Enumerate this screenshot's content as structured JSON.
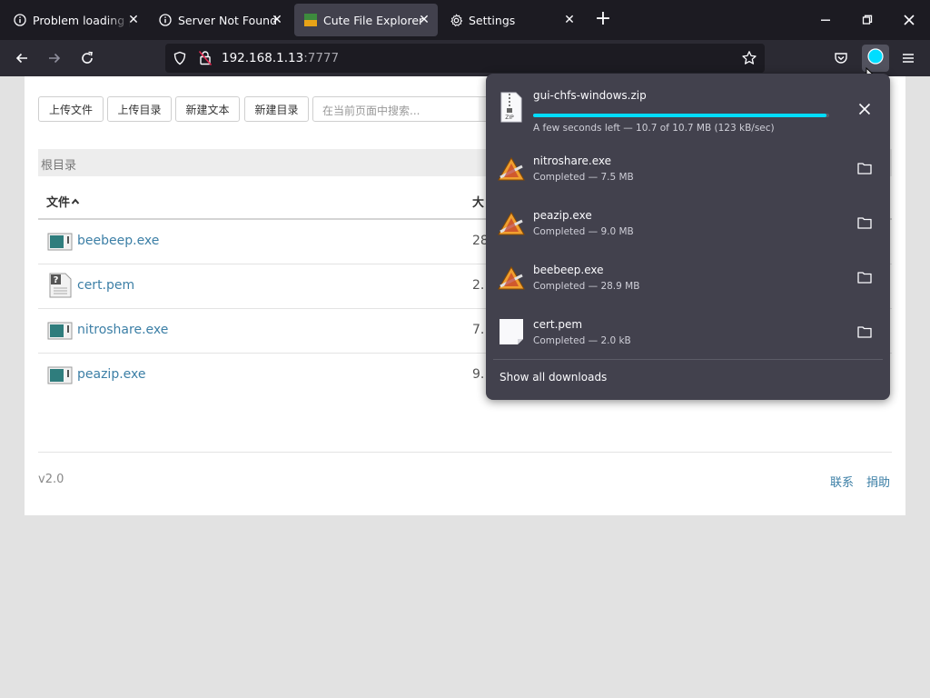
{
  "browser": {
    "tabs": [
      {
        "title": "Problem loading page",
        "icon": "info-icon",
        "active": false
      },
      {
        "title": "Server Not Found",
        "icon": "info-icon",
        "active": false
      },
      {
        "title": "Cute File Explorer",
        "icon": "site-favicon",
        "active": true
      },
      {
        "title": "Settings",
        "icon": "gear-icon",
        "active": false
      }
    ],
    "url_host": "192.168.1.13",
    "url_port": ":7777",
    "accent": "#00ddff"
  },
  "toolbar": {
    "upload_file": "上传文件",
    "upload_dir": "上传目录",
    "new_text": "新建文本",
    "new_dir": "新建目录",
    "search_placeholder": "在当前页面中搜索..."
  },
  "breadcrumb": "根目录",
  "table": {
    "col_file": "文件",
    "col_size": "大",
    "rows": [
      {
        "name": "beebeep.exe",
        "size": "28",
        "icon": "exe-file-icon"
      },
      {
        "name": "cert.pem",
        "size": "2.",
        "icon": "unknown-file-icon"
      },
      {
        "name": "nitroshare.exe",
        "size": "7.",
        "icon": "exe-file-icon"
      },
      {
        "name": "peazip.exe",
        "size": "9.",
        "icon": "exe-file-icon"
      }
    ]
  },
  "footer": {
    "version": "v2.0",
    "contact": "联系",
    "donate": "捐助"
  },
  "downloads": {
    "active": {
      "name": "gui-chfs-windows.zip",
      "status": "A few seconds left — 10.7 of 10.7 MB (123 kB/sec)",
      "progress": 0.99,
      "icon": "zip-file-icon"
    },
    "completed": [
      {
        "name": "nitroshare.exe",
        "status": "Completed — 7.5 MB",
        "icon": "exe-file-icon"
      },
      {
        "name": "peazip.exe",
        "status": "Completed — 9.0 MB",
        "icon": "exe-file-icon"
      },
      {
        "name": "beebeep.exe",
        "status": "Completed — 28.9 MB",
        "icon": "exe-file-icon"
      },
      {
        "name": "cert.pem",
        "status": "Completed — 2.0 kB",
        "icon": "document-icon"
      }
    ],
    "show_all": "Show all downloads"
  }
}
